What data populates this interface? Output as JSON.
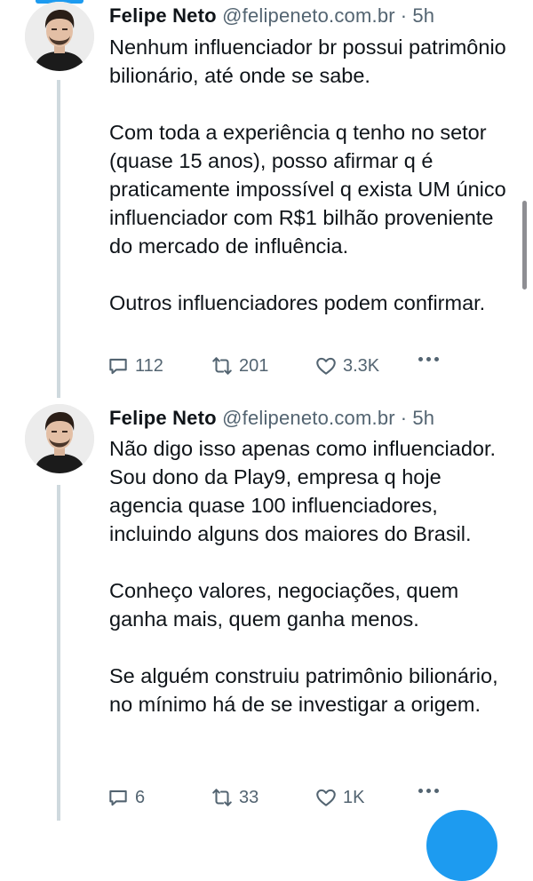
{
  "tweets": [
    {
      "name": "Felipe Neto",
      "handle": "@felipeneto.com.br",
      "separator": "·",
      "time": "5h",
      "paragraphs": [
        "Nenhum influenciador br possui patrimônio bilionário, até onde se sabe.",
        "Com toda a experiência q tenho no setor (quase 15 anos), posso afirmar q é praticamente impossível q exista UM único influenciador com R$1 bilhão proveniente do mercado de influência.",
        "Outros influenciadores podem confirmar."
      ],
      "replies": "112",
      "retweets": "201",
      "likes": "3.3K"
    },
    {
      "name": "Felipe Neto",
      "handle": "@felipeneto.com.br",
      "separator": "·",
      "time": "5h",
      "paragraphs": [
        "Não digo isso apenas como influenciador. Sou dono da Play9, empresa q hoje agencia quase 100 influenciadores, incluindo alguns dos maiores do Brasil.",
        "Conheço valores, negociações, quem ganha mais, quem ganha menos.",
        "Se alguém construiu patrimônio bilionário, no mínimo há de se investigar a origem."
      ],
      "replies": "6",
      "retweets": "33",
      "likes": "1K"
    }
  ],
  "icons": {
    "reply": "reply-icon",
    "retweet": "retweet-icon",
    "like": "heart-icon",
    "more": "more-icon"
  },
  "colors": {
    "accent": "#1d9bf0",
    "secondary_text": "#536471",
    "thread_line": "#cfd9de"
  }
}
